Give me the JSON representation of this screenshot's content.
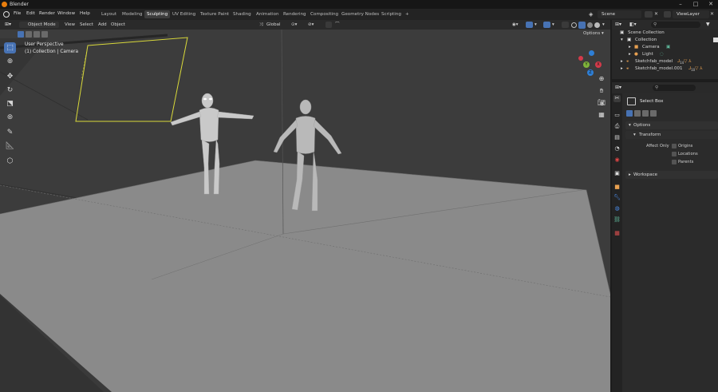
{
  "titlebar": {
    "app_title": "Blender",
    "minimize": "–",
    "maximize": "□",
    "close": "✕"
  },
  "menu": {
    "file": "File",
    "edit": "Edit",
    "render": "Render",
    "window": "Window",
    "help": "Help"
  },
  "workspaces": [
    "Layout",
    "Modeling",
    "Sculpting",
    "UV Editing",
    "Texture Paint",
    "Shading",
    "Animation",
    "Rendering",
    "Compositing",
    "Geometry Nodes",
    "Scripting"
  ],
  "active_workspace": "Sculpting",
  "add_workspace": "+",
  "scene": {
    "label": "Scene"
  },
  "viewlayer": {
    "label": "ViewLayer"
  },
  "viewport_header": {
    "mode": "Object Mode",
    "view": "View",
    "select": "Select",
    "add": "Add",
    "object": "Object",
    "transform_orientation": "Global",
    "options": "Options"
  },
  "viewport": {
    "perspective": "User Perspective",
    "collection_info": "(1) Collection | Camera",
    "gizmo": {
      "x": "X",
      "y": "Y",
      "z": "Z"
    }
  },
  "outliner": {
    "scene_collection": "Scene Collection",
    "rows": [
      {
        "label": "Collection"
      },
      {
        "label": "Camera"
      },
      {
        "label": "Light"
      },
      {
        "label": "Sketchfab_model",
        "badge": "14"
      },
      {
        "label": "Sketchfab_model.001",
        "badge": "10"
      }
    ]
  },
  "properties": {
    "tool_name": "Select Box",
    "options_panel": "Options",
    "transform_panel": "Transform",
    "affect_only": "Affect Only",
    "checkboxes": [
      "Origins",
      "Locations",
      "Parents"
    ],
    "workspace_panel": "Workspace"
  },
  "colors": {
    "accent": "#4772b3",
    "camera_frame": "#d9d93a",
    "floor": "#888888",
    "viewport_bg": "#3c3c3c"
  }
}
